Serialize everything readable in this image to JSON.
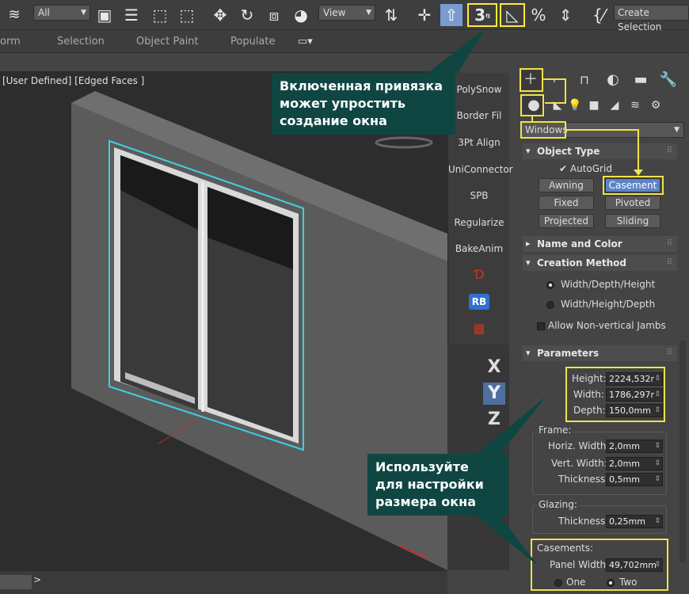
{
  "toolbar": {
    "filter_value": "All",
    "view_value": "View",
    "snap_label": "3",
    "create_selection": "Create Selection"
  },
  "ribbon_tabs": [
    "orm",
    "Selection",
    "Object Paint",
    "Populate"
  ],
  "viewport": {
    "label": "[User Defined] [Edged Faces ]"
  },
  "scripts": [
    "PolySnow",
    "Border Fil",
    "3Pt Align",
    "UniConnector",
    "SPB",
    "Regularize",
    "BakeAnim"
  ],
  "script_icons": {
    "rb_label": "RB"
  },
  "axes": [
    "X",
    "Y",
    "Z"
  ],
  "panel": {
    "category_dropdown": "Windows",
    "object_type": {
      "title": "Object Type",
      "autogrid": "AutoGrid",
      "buttons": [
        "Awning",
        "Casement",
        "Fixed",
        "Pivoted",
        "Projected",
        "Sliding"
      ],
      "active": "Casement"
    },
    "name_color": {
      "title": "Name and Color"
    },
    "creation_method": {
      "title": "Creation Method",
      "options": [
        "Width/Depth/Height",
        "Width/Height/Depth"
      ],
      "selected": "Width/Depth/Height",
      "jambs": "Allow Non-vertical Jambs"
    },
    "parameters": {
      "title": "Parameters",
      "height_label": "Height:",
      "height": "2224,532r",
      "width_label": "Width:",
      "width": "1786,297r",
      "depth_label": "Depth:",
      "depth": "150,0mm",
      "frame_label": "Frame:",
      "horiz_label": "Horiz. Width:",
      "horiz": "2,0mm",
      "vert_label": "Vert. Width:",
      "vert": "2,0mm",
      "thick_label": "Thickness:",
      "thick": "0,5mm",
      "glazing_label": "Glazing:",
      "gthick_label": "Thickness:",
      "gthick": "0,25mm",
      "casements_label": "Casements:",
      "panel_label": "Panel Width:",
      "panel_width": "49,702mm",
      "one": "One",
      "two": "Two"
    }
  },
  "callouts": {
    "snap": "Включенная привязка может упростить создание окна",
    "size": "Используйте для настройки размера окна"
  },
  "status": {
    "arrow": ">"
  },
  "colors": {
    "highlight": "#f0e24a",
    "callout_bg": "#0f4642",
    "selection": "#3fd0e0",
    "active_button": "#5d84c7"
  }
}
